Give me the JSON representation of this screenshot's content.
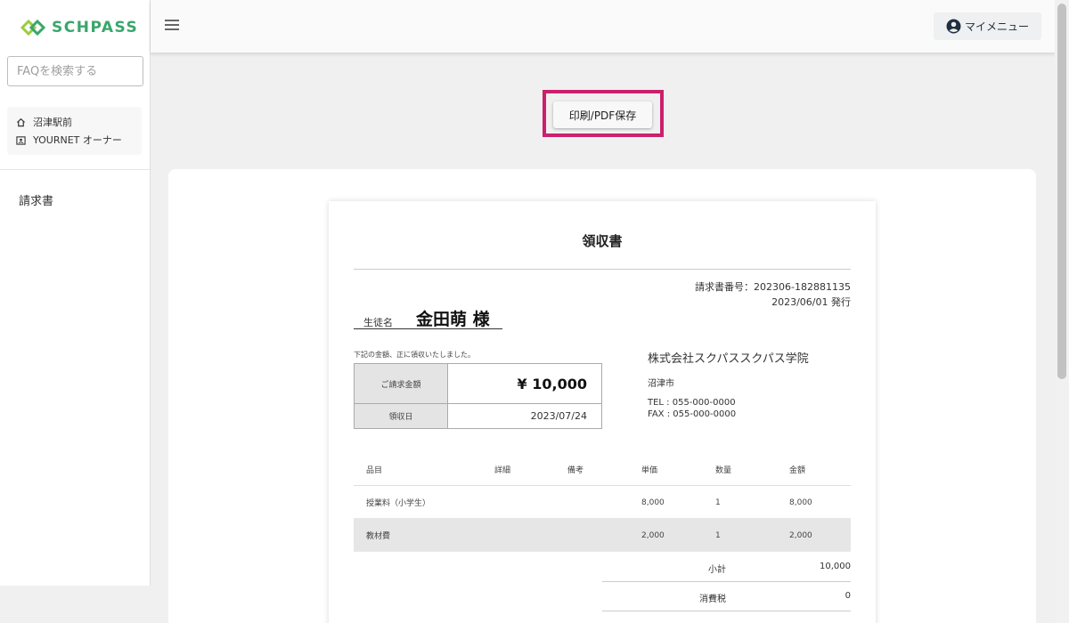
{
  "app": {
    "logo_text": "SCHPASS"
  },
  "sidebar": {
    "faq_placeholder": "FAQを検索する",
    "school": "沼津駅前",
    "owner": "YOURNET オーナー",
    "nav_items": [
      {
        "label": "請求書"
      }
    ]
  },
  "header": {
    "my_menu": "マイメニュー"
  },
  "actions": {
    "print_label": "印刷/PDF保存"
  },
  "receipt": {
    "title": "領収書",
    "invoice_number": "請求書番号：202306-182881135",
    "issued": "2023/06/01 発行",
    "student_label": "生徒名",
    "student_name": "金田萌 様",
    "note": "下記の金額、正に領収いたしました。",
    "billing_amount_label": "ご請求金額",
    "billing_amount": "¥ 10,000",
    "received_date_label": "領収日",
    "received_date": "2023/07/24",
    "company": "株式会社スクパススクパス学院",
    "city": "沼津市",
    "tel": "TEL : 055-000-0000",
    "fax": "FAX : 055-000-0000",
    "columns": [
      "品目",
      "詳細",
      "備考",
      "単価",
      "数量",
      "金額"
    ],
    "items": [
      {
        "name": "授業料（小学生）",
        "detail": "",
        "note": "",
        "unit_price": "8,000",
        "quantity": "1",
        "amount": "8,000"
      },
      {
        "name": "教材費",
        "detail": "",
        "note": "",
        "unit_price": "2,000",
        "quantity": "1",
        "amount": "2,000"
      }
    ],
    "subtotal_label": "小計",
    "subtotal": "10,000",
    "tax_label": "消費税",
    "tax": "0"
  },
  "colors": {
    "brand": "#3aa66b",
    "highlight": "#cc1f6d"
  }
}
